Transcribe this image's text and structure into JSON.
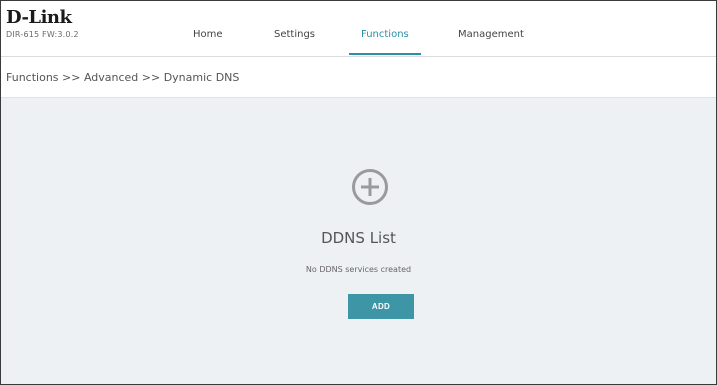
{
  "header": {
    "brand": "D-Link",
    "model_firmware": "DIR-615 FW:3.0.2"
  },
  "nav": {
    "items": [
      {
        "label": "Home"
      },
      {
        "label": "Settings"
      },
      {
        "label": "Functions",
        "active": true
      },
      {
        "label": "Management"
      }
    ],
    "accent_color": "#2a90a6"
  },
  "breadcrumb": {
    "text": "Functions >> Advanced >> Dynamic DNS"
  },
  "ddns": {
    "add_icon": "plus-circle-icon",
    "title": "DDNS List",
    "empty_message": "No DDNS services created",
    "add_button_label": "ADD",
    "button_color": "#3d95a6"
  }
}
